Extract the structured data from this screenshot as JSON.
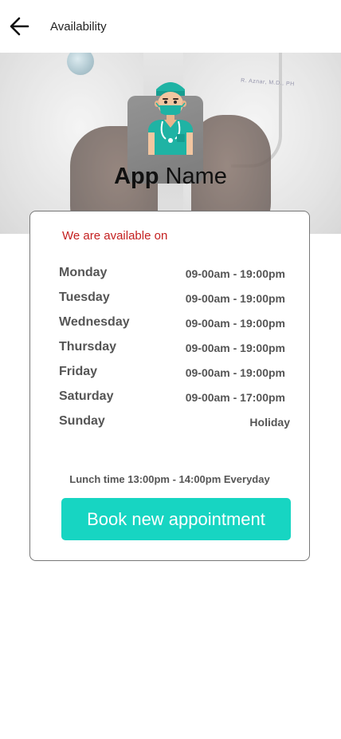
{
  "header": {
    "title": "Availability",
    "back_icon": "arrow-left-icon"
  },
  "hero": {
    "logo_icon": "doctor-icon",
    "app_name_bold": "App",
    "app_name_regular": " Name",
    "badge_text": "R. Aznar, M.D., PH"
  },
  "card": {
    "heading": "We are available on",
    "schedule": [
      {
        "day": "Monday",
        "hours": "09-00am - 19:00pm"
      },
      {
        "day": "Tuesday",
        "hours": "09-00am - 19:00pm"
      },
      {
        "day": "Wednesday",
        "hours": "09-00am - 19:00pm"
      },
      {
        "day": "Thursday",
        "hours": "09-00am - 19:00pm"
      },
      {
        "day": "Friday",
        "hours": "09-00am - 19:00pm"
      },
      {
        "day": "Saturday",
        "hours": "09-00am - 17:00pm"
      },
      {
        "day": "Sunday",
        "hours": "Holiday"
      }
    ],
    "lunch": "Lunch time 13:00pm - 14:00pm Everyday",
    "book_button": "Book new appointment"
  },
  "colors": {
    "accent": "#17d5c2",
    "heading_red": "#c41f1f"
  }
}
